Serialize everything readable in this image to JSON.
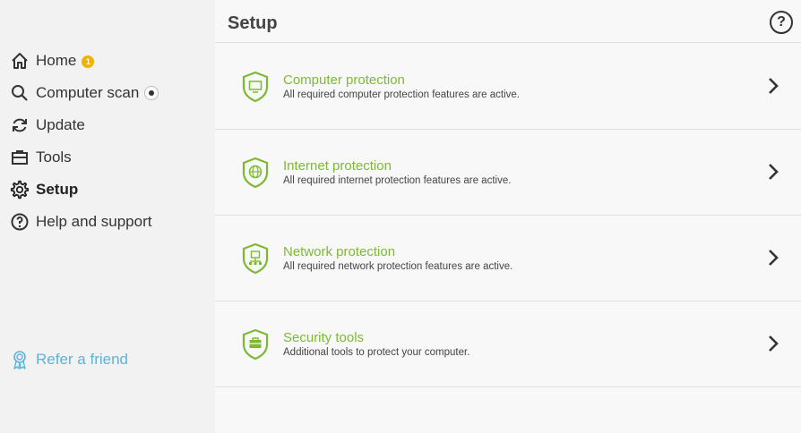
{
  "sidebar": {
    "items": [
      {
        "label": "Home",
        "icon": "home-icon",
        "badge": "1"
      },
      {
        "label": "Computer scan",
        "icon": "search-icon"
      },
      {
        "label": "Update",
        "icon": "refresh-icon"
      },
      {
        "label": "Tools",
        "icon": "toolbox-icon"
      },
      {
        "label": "Setup",
        "icon": "gear-icon",
        "active": true
      },
      {
        "label": "Help and support",
        "icon": "question-icon"
      }
    ],
    "refer": {
      "label": "Refer a friend",
      "icon": "ribbon-icon"
    }
  },
  "header": {
    "title": "Setup",
    "help_icon": "question-circle-icon",
    "help_label": "?"
  },
  "rows": [
    {
      "title": "Computer protection",
      "desc": "All required computer protection features are active.",
      "icon": "shield-monitor-icon"
    },
    {
      "title": "Internet protection",
      "desc": "All required internet protection features are active.",
      "icon": "shield-globe-icon"
    },
    {
      "title": "Network protection",
      "desc": "All required network protection features are active.",
      "icon": "shield-network-icon"
    },
    {
      "title": "Security tools",
      "desc": "Additional tools to protect your computer.",
      "icon": "shield-toolbox-icon"
    }
  ],
  "colors": {
    "accent": "#7dba34",
    "link": "#5ab4dc",
    "badge": "#f0b400"
  }
}
